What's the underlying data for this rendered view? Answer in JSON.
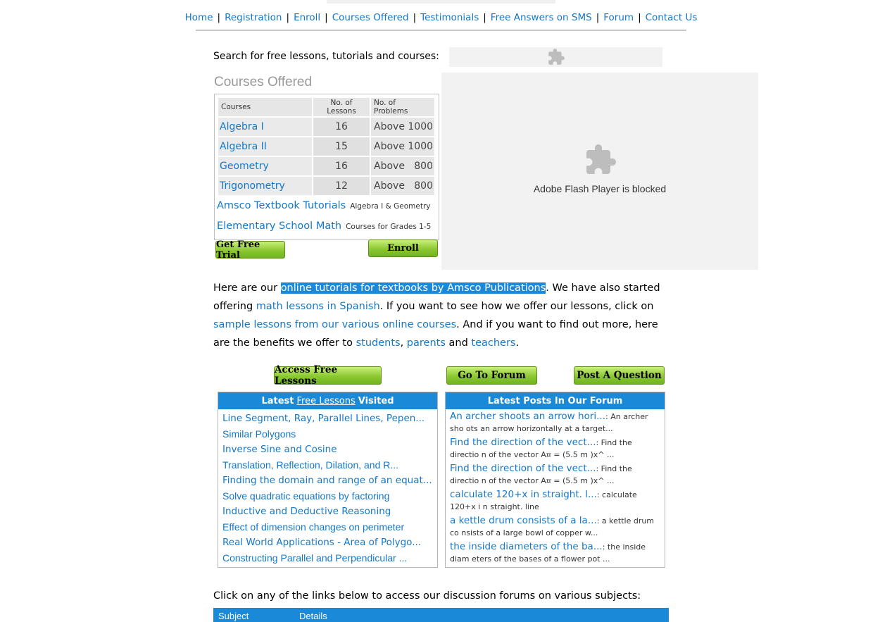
{
  "nav": {
    "items": [
      "Home",
      "Registration",
      "Enroll",
      "Courses Offered",
      "Testimonials",
      "Free Answers on SMS",
      "Forum",
      "Contact Us"
    ],
    "separator": "|"
  },
  "search": {
    "label": "Search for free lessons, tutorials and courses:"
  },
  "courses": {
    "title": "Courses Offered",
    "headers": [
      "Courses",
      "No. of Lessons",
      "No. of Problems"
    ],
    "rows": [
      {
        "name": "Algebra I",
        "lessons": "16",
        "problems": "Above 1000"
      },
      {
        "name": "Algebra II",
        "lessons": "15",
        "problems": "Above 1000"
      },
      {
        "name": "Geometry",
        "lessons": "16",
        "problems": "Above   800"
      },
      {
        "name": "Trigonometry",
        "lessons": "12",
        "problems": "Above   800"
      }
    ],
    "extra": [
      {
        "name": "Amsco Textbook Tutorials",
        "note": "Algebra I & Geometry"
      },
      {
        "name": "Elementary School Math",
        "note": "Courses for Grades 1-5"
      }
    ],
    "trial_button": "Get Free Trial",
    "enroll_button": "Enroll"
  },
  "flash": {
    "text": "Adobe Flash Player is blocked"
  },
  "intro": {
    "t1": "Here are our ",
    "l1": "online tutorials for textbooks by Amsco Publications",
    "t2": ". We have also started offering ",
    "l2": "math lessons in Spanish",
    "t3": ". If you want to see how we offer our lessons, click on ",
    "l3": "sample lessons from our various online courses",
    "t4": ". And if you want to find out more, here are the benefits we offer to ",
    "l4": "students",
    "t5": ", ",
    "l5": "parents",
    "t6": " and ",
    "l6": "teachers",
    "t7": "."
  },
  "buttons": {
    "access": "Access Free Lessons",
    "forum": "Go To Forum",
    "post": "Post A Question"
  },
  "lessons_panel": {
    "head_pre": "Latest",
    "head_link": "Free Lessons",
    "head_post": "Visited",
    "items": [
      "Line Segment, Ray, Parallel Lines, Pepen...",
      "Similar Polygons",
      "Inverse Sine and Cosine",
      "Translation, Reflection, Dilation, and R...",
      "Finding the domain and range of an equat...",
      "Solve quadratic equations by factoring",
      "Inductive and Deductive Reasoning",
      "Effect of dimension changes on perimeter",
      "Real World Applications - Area of Polygo...",
      "Constructing Parallel and Perpendicular ..."
    ]
  },
  "posts_panel": {
    "head": "Latest Posts In Our Forum",
    "items": [
      {
        "title": "An archer shoots an arrow hori...",
        "desc": ": An archer sho ots an arrow horizontally at a target..."
      },
      {
        "title": "Find the direction of the vect...",
        "desc": ": Find the directio n of the vector A¤ = (5.5 m )x^ ..."
      },
      {
        "title": "Find the direction of the vect...",
        "desc": ": Find the directio n of the vector A¤ = (5.5 m )x^ ..."
      },
      {
        "title": "calculate 120+x in straight. l...",
        "desc": ": calculate 120+x i n straight. line"
      },
      {
        "title": "a kettle drum consists of a la...",
        "desc": ": a kettle drum co nsists of a large bowl of copper w..."
      },
      {
        "title": "the inside diameters of the ba...",
        "desc": ": the inside diam eters of the bases of a flower pot ..."
      }
    ]
  },
  "forum_section": {
    "label": "Click on any of the links below to access our discussion forums on various subjects:",
    "columns": [
      "Subject",
      "Details"
    ]
  }
}
